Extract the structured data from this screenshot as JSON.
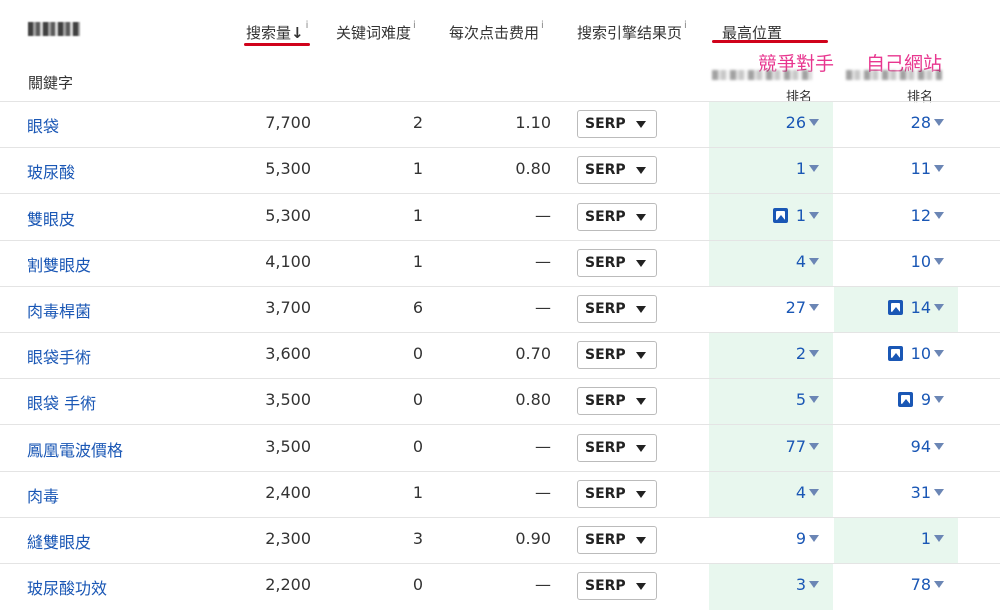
{
  "columns": {
    "keyword": "關鍵字",
    "volume": "搜索量",
    "volume_sort": "↓",
    "difficulty": "关键词难度",
    "cpc": "每次点击费用",
    "serp": "搜索引擎结果页",
    "best_position": "最高位置",
    "info_mark": "i"
  },
  "annotations": {
    "competitor": "競爭對手",
    "own_site": "自己網站"
  },
  "rank_label": "排名",
  "serp_button_label": "SERP",
  "rows": [
    {
      "keyword": "眼袋",
      "volume": "7,700",
      "difficulty": "2",
      "cpc": "1.10",
      "competitor_rank": "26",
      "own_rank": "28",
      "competitor_image": false,
      "own_image": false
    },
    {
      "keyword": "玻尿酸",
      "volume": "5,300",
      "difficulty": "1",
      "cpc": "0.80",
      "competitor_rank": "1",
      "own_rank": "11",
      "competitor_image": false,
      "own_image": false
    },
    {
      "keyword": "雙眼皮",
      "volume": "5,300",
      "difficulty": "1",
      "cpc": "—",
      "competitor_rank": "1",
      "own_rank": "12",
      "competitor_image": true,
      "own_image": false
    },
    {
      "keyword": "割雙眼皮",
      "volume": "4,100",
      "difficulty": "1",
      "cpc": "—",
      "competitor_rank": "4",
      "own_rank": "10",
      "competitor_image": false,
      "own_image": false
    },
    {
      "keyword": "肉毒桿菌",
      "volume": "3,700",
      "difficulty": "6",
      "cpc": "—",
      "competitor_rank": "27",
      "own_rank": "14",
      "competitor_image": false,
      "own_image": true
    },
    {
      "keyword": "眼袋手術",
      "volume": "3,600",
      "difficulty": "0",
      "cpc": "0.70",
      "competitor_rank": "2",
      "own_rank": "10",
      "competitor_image": false,
      "own_image": true
    },
    {
      "keyword": "眼袋 手術",
      "volume": "3,500",
      "difficulty": "0",
      "cpc": "0.80",
      "competitor_rank": "5",
      "own_rank": "9",
      "competitor_image": false,
      "own_image": true
    },
    {
      "keyword": "鳳凰電波價格",
      "volume": "3,500",
      "difficulty": "0",
      "cpc": "—",
      "competitor_rank": "77",
      "own_rank": "94",
      "competitor_image": false,
      "own_image": false
    },
    {
      "keyword": "肉毒",
      "volume": "2,400",
      "difficulty": "1",
      "cpc": "—",
      "competitor_rank": "4",
      "own_rank": "31",
      "competitor_image": false,
      "own_image": false
    },
    {
      "keyword": "縫雙眼皮",
      "volume": "2,300",
      "difficulty": "3",
      "cpc": "0.90",
      "competitor_rank": "9",
      "own_rank": "1",
      "competitor_image": false,
      "own_image": false
    },
    {
      "keyword": "玻尿酸功效",
      "volume": "2,200",
      "difficulty": "0",
      "cpc": "—",
      "competitor_rank": "3",
      "own_rank": "78",
      "competitor_image": false,
      "own_image": false
    }
  ],
  "highlight": {
    "competitor_best_rows": [
      0,
      1,
      2,
      3,
      5,
      6,
      7,
      8,
      10
    ],
    "own_best_rows": [
      4,
      9
    ]
  },
  "colors": {
    "link": "#1a57b5",
    "highlight_bg": "#e8f7ee",
    "annotation": "#e8368f",
    "underline": "#d0021b"
  }
}
